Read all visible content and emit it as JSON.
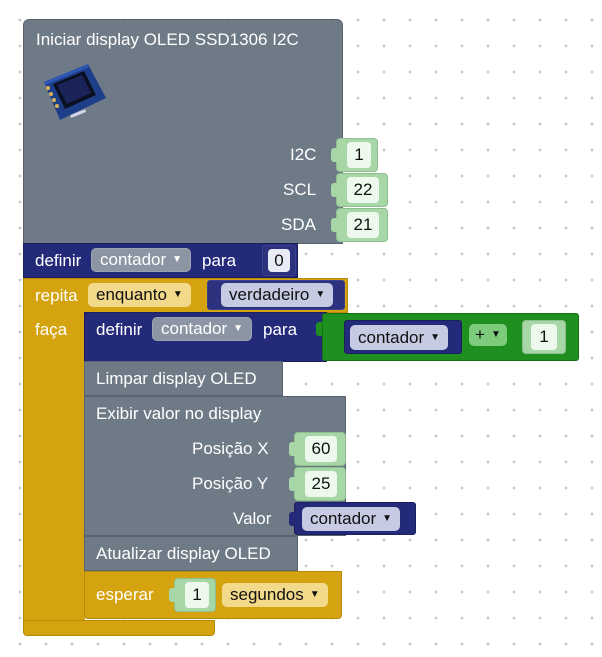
{
  "init_block": {
    "title": "Iniciar display OLED SSD1306 I2C",
    "i2c_label": "I2C",
    "i2c_value": "1",
    "scl_label": "SCL",
    "scl_value": "22",
    "sda_label": "SDA",
    "sda_value": "21"
  },
  "set_block": {
    "keyword": "definir",
    "variable": "contador",
    "to": "para",
    "value": "0"
  },
  "loop_block": {
    "repeat": "repita",
    "mode": "enquanto",
    "condition": "verdadeiro",
    "do": "faça"
  },
  "inner_set": {
    "keyword": "definir",
    "variable": "contador",
    "to": "para",
    "operand_var": "contador",
    "operator": "+",
    "operand_num": "1"
  },
  "clear_block": {
    "label": "Limpar display OLED"
  },
  "show_block": {
    "title": "Exibir valor no display",
    "posx_label": "Posição X",
    "posx_value": "60",
    "posy_label": "Posição Y",
    "posy_value": "25",
    "value_label": "Valor",
    "value_var": "contador"
  },
  "update_block": {
    "label": "Atualizar display OLED"
  },
  "wait_block": {
    "label": "esperar",
    "value": "1",
    "unit": "segundos"
  },
  "colors": {
    "display_block": "#6f7a87",
    "variable_block": "#242a7a",
    "control_block": "#d4a30f",
    "math_block": "#1f8f1f",
    "number_field": "#a7d6a7"
  }
}
